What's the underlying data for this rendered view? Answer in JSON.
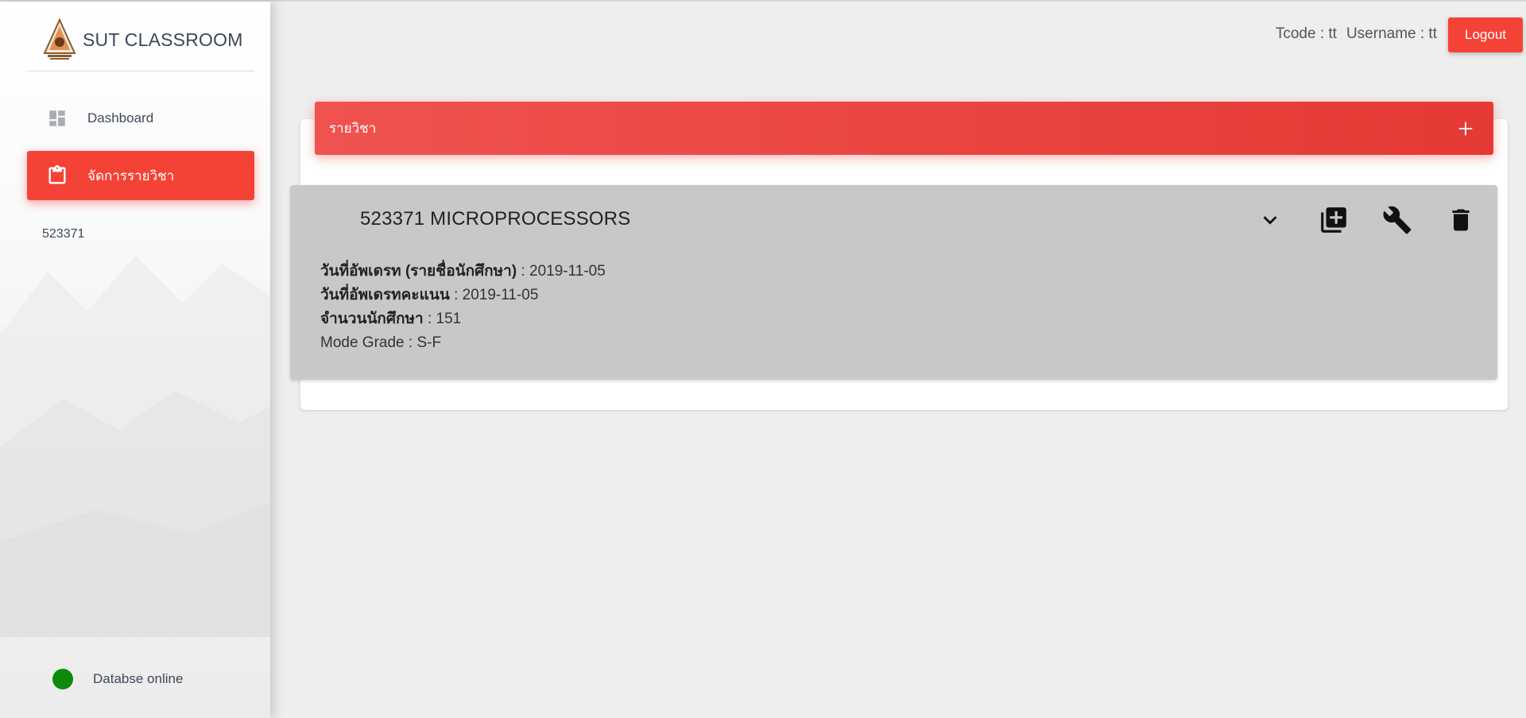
{
  "app": {
    "title": "SUT CLASSROOM"
  },
  "sidebar": {
    "items": [
      {
        "label": "Dashboard",
        "icon": "dashboard-icon",
        "active": false
      },
      {
        "label": "จัดการรายวิชา",
        "icon": "clipboard-icon",
        "active": true
      }
    ],
    "sub_items": [
      "523371"
    ],
    "db_status": {
      "label": "Databse online",
      "color": "#0b8a0b"
    }
  },
  "header": {
    "tcode": "Tcode : tt",
    "username": "Username : tt",
    "logout_label": "Logout"
  },
  "card": {
    "title": "รายวิชา",
    "add_icon": "plus-icon"
  },
  "course": {
    "name": "523371 MICROPROCESSORS",
    "details": [
      {
        "label": "วันที่อัพเดรท (รายชื่อนักศึกษา)",
        "value": " : 2019-11-05",
        "bold": true
      },
      {
        "label": "วันที่อัพเดรทคะแนน",
        "value": " : 2019-11-05",
        "bold": true
      },
      {
        "label": "จำนวนนักศึกษา",
        "value": " : 151",
        "bold": true
      },
      {
        "label": "Mode Grade",
        "value": " : S-F",
        "bold": false
      }
    ],
    "actions": [
      "chevron-down-icon",
      "library-add-icon",
      "wrench-icon",
      "trash-icon"
    ]
  },
  "colors": {
    "accent": "#f44336",
    "panel": "#c8c8c8",
    "background": "#eeeeee"
  }
}
